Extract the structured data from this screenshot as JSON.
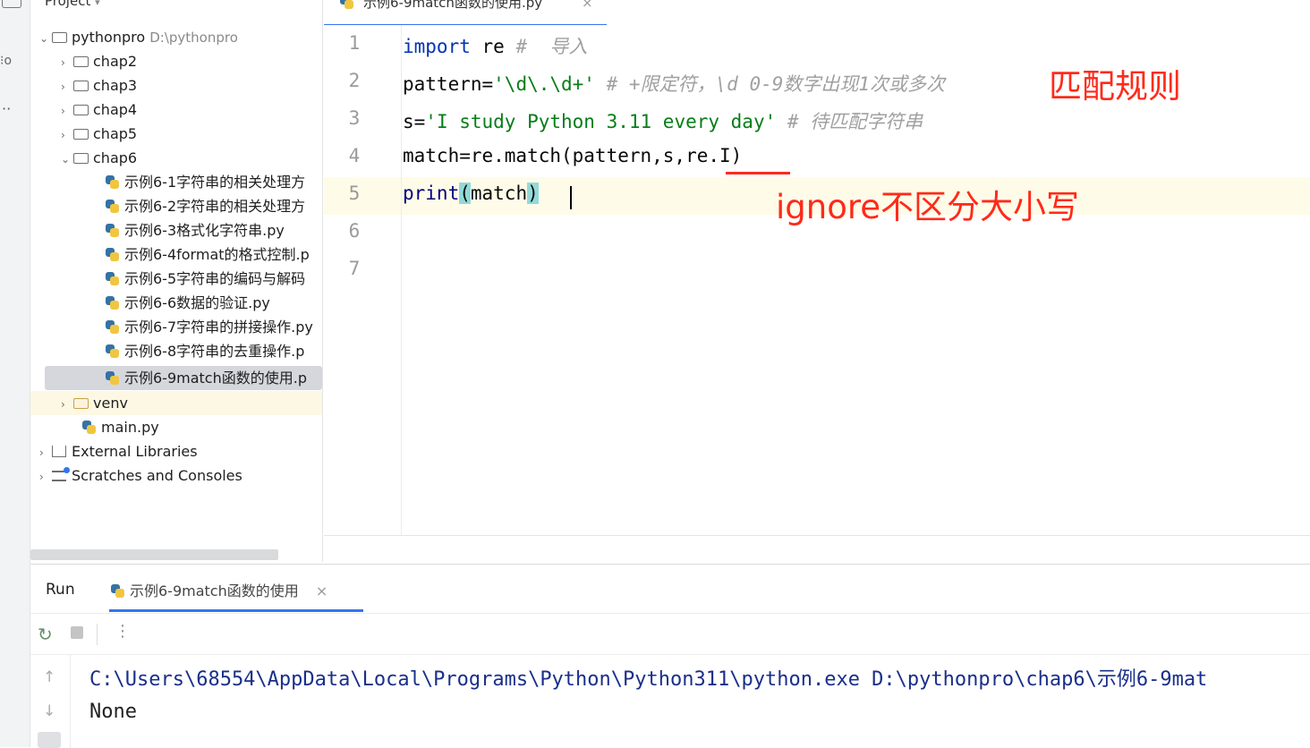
{
  "project": {
    "header": "Project",
    "root": {
      "name": "pythonpro",
      "path": "D:\\pythonpro"
    },
    "folders": [
      "chap2",
      "chap3",
      "chap4",
      "chap5",
      "chap6"
    ],
    "chap6_files": [
      "示例6-1字符串的相关处理方",
      "示例6-2字符串的相关处理方",
      "示例6-3格式化字符串.py",
      "示例6-4format的格式控制.p",
      "示例6-5字符串的编码与解码",
      "示例6-6数据的验证.py",
      "示例6-7字符串的拼接操作.py",
      "示例6-8字符串的去重操作.p",
      "示例6-9match函数的使用.p"
    ],
    "venv": "venv",
    "main": "main.py",
    "external": "External Libraries",
    "scratches": "Scratches and Consoles"
  },
  "editor": {
    "tab_label": "示例6-9match函数的使用.py",
    "line_numbers": [
      "1",
      "2",
      "3",
      "4",
      "5",
      "6",
      "7"
    ],
    "lines": {
      "l1_kw": "import",
      "l1_rest": " re ",
      "l1_cmt": "#  导入",
      "l2_a": "pattern=",
      "l2_str": "'\\d\\.\\d+'",
      "l2_cmt": " # +限定符，\\d 0-9数字出现1次或多次",
      "l3_a": "s=",
      "l3_str": "'I study Python 3.11 every day'",
      "l3_cmt": " # 待匹配字符串",
      "l4": "match=re.match(pattern,s,re.I)",
      "l5_fn": "print",
      "l5_open": "(",
      "l5_arg": "match",
      "l5_close": ")"
    },
    "annotations": {
      "rule": "匹配规则",
      "ignore": "ignore不区分大小写"
    }
  },
  "run": {
    "label": "Run",
    "tab_label": "示例6-9match函数的使用",
    "output": [
      "C:\\Users\\68554\\AppData\\Local\\Programs\\Python\\Python311\\python.exe D:\\pythonpro\\chap6\\示例6-9mat",
      "None"
    ]
  },
  "colors": {
    "accent": "#3574f0",
    "annotation": "#ff2a1a",
    "keyword": "#0033b3",
    "string": "#067d17"
  }
}
